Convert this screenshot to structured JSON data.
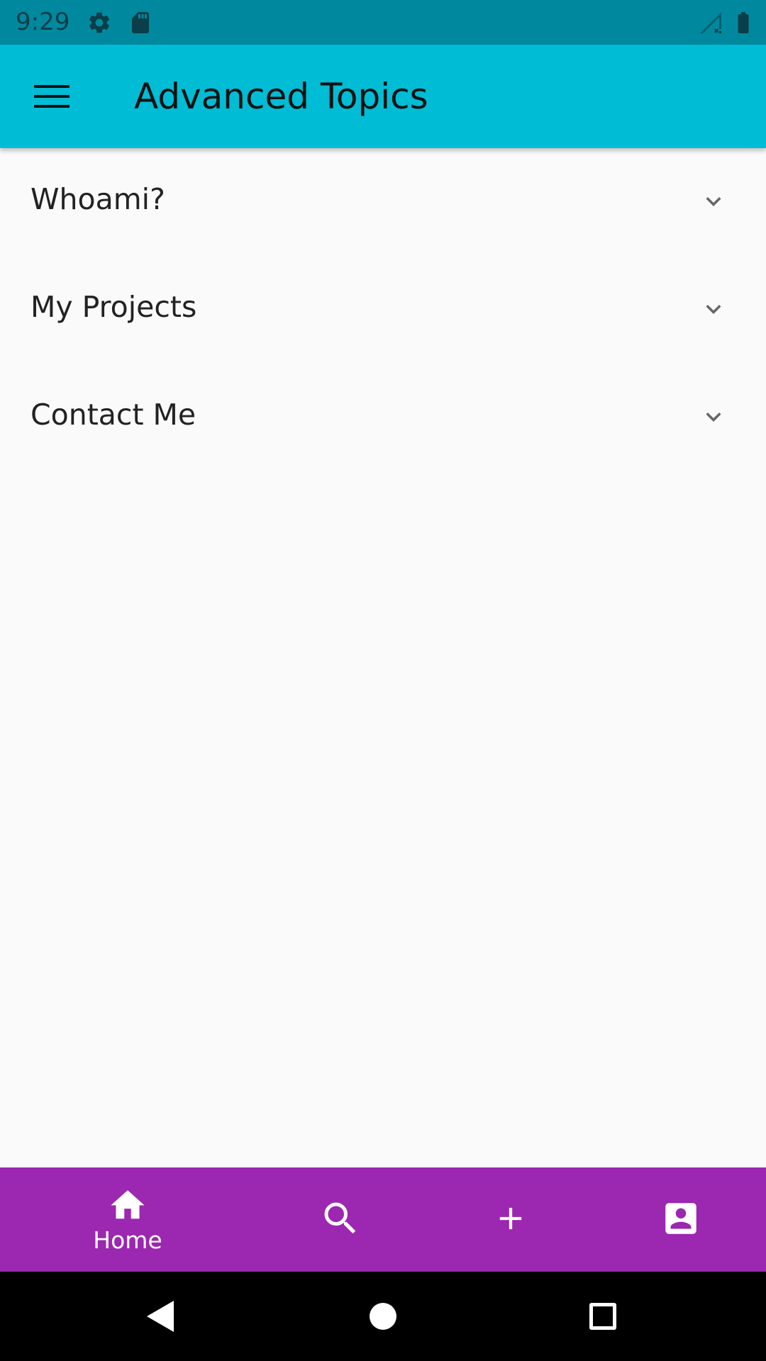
{
  "status_bar": {
    "time": "9:29",
    "left_icons": [
      "gear-icon",
      "sd-card-icon"
    ],
    "right_icons": [
      "signal-off-icon",
      "battery-icon"
    ],
    "background": "#00899e"
  },
  "app_bar": {
    "title": "Advanced Topics",
    "menu_icon": "hamburger-menu-icon",
    "background": "#00bcd4"
  },
  "list": {
    "items": [
      {
        "label": "Whoami?",
        "icon": "chevron-down-icon"
      },
      {
        "label": "My Projects",
        "icon": "chevron-down-icon"
      },
      {
        "label": "Contact Me",
        "icon": "chevron-down-icon"
      }
    ]
  },
  "bottom_nav": {
    "background": "#9c27b0",
    "items": [
      {
        "label": "Home",
        "icon": "home-icon",
        "selected": true
      },
      {
        "label": "",
        "icon": "search-icon",
        "selected": false
      },
      {
        "label": "",
        "icon": "plus-icon",
        "selected": false
      },
      {
        "label": "",
        "icon": "account-box-icon",
        "selected": false
      }
    ]
  },
  "system_nav": {
    "buttons": [
      "back-icon",
      "home-circle-icon",
      "recents-icon"
    ]
  }
}
